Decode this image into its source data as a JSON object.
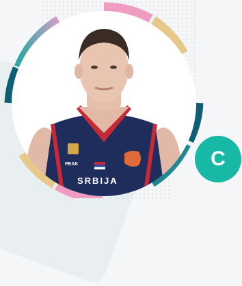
{
  "profile": {
    "jersey_text": "SRBIJA",
    "brand_text": "PEAK",
    "action_button_label": "C"
  },
  "colors": {
    "accent_teal": "#17b8a6",
    "jersey_navy": "#1f2d5c",
    "jersey_red": "#c62a36",
    "ring_pink": "#ef9bc2",
    "ring_gold": "#e6c98a",
    "ring_dark_teal": "#0f5f74"
  },
  "icons": {
    "action_button": "c-letter-icon"
  }
}
